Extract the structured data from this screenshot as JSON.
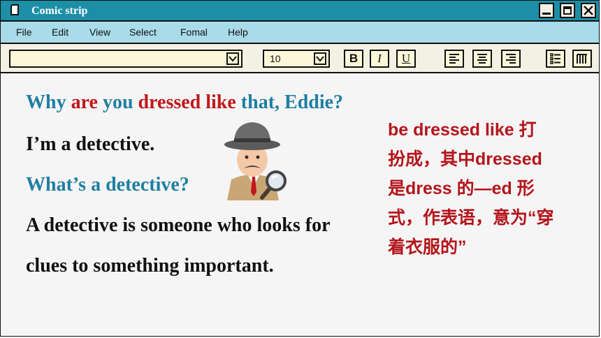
{
  "window": {
    "title": "Comic strip"
  },
  "menu": [
    "File",
    "Edit",
    "View",
    "Select",
    "Fomal",
    "Help"
  ],
  "toolbar": {
    "font_value": "",
    "font_size": "10",
    "bold_label": "B",
    "italic_label": "I",
    "underline_label": "U"
  },
  "dialogue": {
    "q1_parts": [
      "Why ",
      "are ",
      "you ",
      "dressed like ",
      "that, Eddie?"
    ],
    "a1": "I’m a detective.",
    "q2": "What’s a detective?",
    "a2_line1": "A detective is someone who looks for",
    "a2_line2": "clues to something important."
  },
  "note": {
    "lines": [
      "be dressed like 打",
      "扮成，其中dressed",
      "是dress 的—ed 形",
      "式，作表语，意为“穿",
      "着衣服的”"
    ]
  },
  "colors": {
    "blue": "#1f7fa3",
    "red": "#c0171c",
    "titlebar": "#1c8fa6",
    "menubar": "#a9dbe9"
  },
  "icons": [
    "document-icon",
    "minimize-icon",
    "maximize-icon",
    "close-icon",
    "dropdown-arrow-icon",
    "align-left-icon",
    "align-center-icon",
    "align-right-icon",
    "bullet-list-icon",
    "columns-icon",
    "detective-emoji"
  ]
}
